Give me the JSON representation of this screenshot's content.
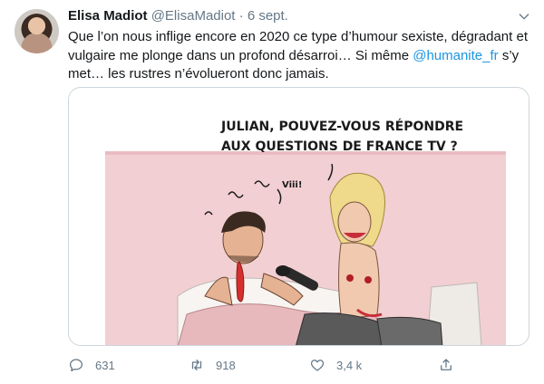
{
  "tweet": {
    "display_name": "Elisa Madiot",
    "handle": "@ElisaMadiot",
    "separator": "·",
    "date": "6 sept.",
    "text_before": "Que l’on nous inflige encore en 2020 ce type d’humour sexiste, dégradant et vulgaire me plonge dans un profond désarroi… Si même ",
    "mention": "@humanite_fr",
    "text_after": " s’y met… les rustres n’évolueront donc jamais.",
    "media": {
      "speech_line1": "JULIAN, POUVEZ-VOUS RÉPONDRE",
      "speech_line2": "AUX QUESTIONS DE FRANCE TV ?",
      "sound": "Viii!"
    },
    "actions": {
      "replies": "631",
      "retweets": "918",
      "likes": "3,4 k"
    },
    "icons": {
      "reply": "reply-icon",
      "retweet": "retweet-icon",
      "like": "heart-icon",
      "share": "share-icon",
      "caret": "chevron-down-icon"
    },
    "colors": {
      "text": "#14171a",
      "secondary": "#657786",
      "link": "#1b95e0",
      "border": "#ccd6dd"
    }
  }
}
